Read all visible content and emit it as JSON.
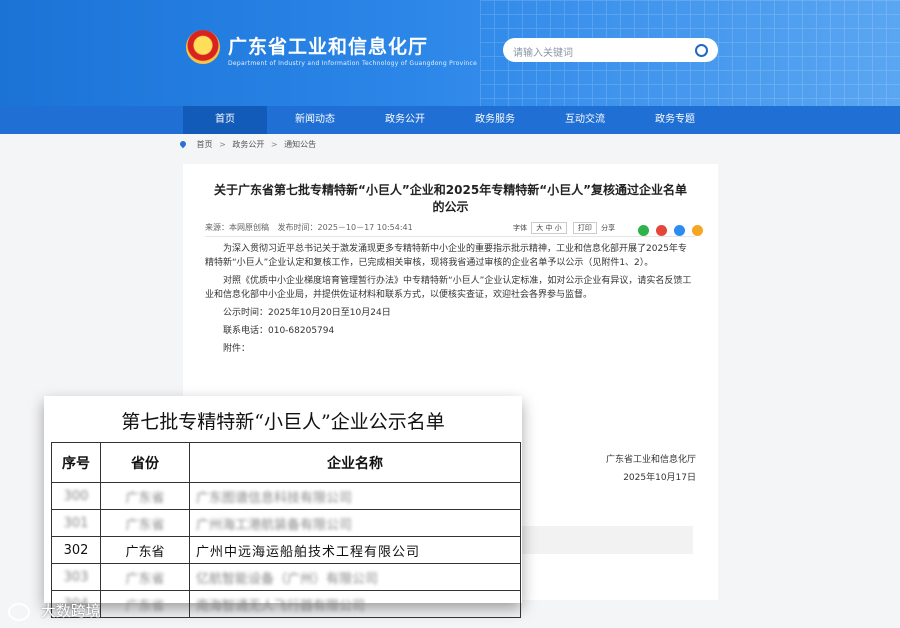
{
  "header": {
    "site_title": "广东省工业和信息化厅",
    "site_subtitle": "Department of Industry and Information Technology of Guangdong Province",
    "search_placeholder": "请输入关键词"
  },
  "nav": {
    "items": [
      "首页",
      "新闻动态",
      "政务公开",
      "政务服务",
      "互动交流",
      "政务专题"
    ]
  },
  "breadcrumb": [
    "首页",
    "政务公开",
    "通知公告"
  ],
  "article": {
    "title_line1": "关于广东省第七批专精特新“小巨人”企业和2025年专精特新“小巨人”复核通过企业名单",
    "title_line2": "的公示",
    "meta_source": "来源：本网原创稿",
    "meta_time": "发布时间：2025－10－17 10:54:41",
    "font_label": "字体",
    "font_sizes": "大 中 小",
    "print_label": "打印",
    "share_label": "分享",
    "paragraph1": "为深入贯彻习近平总书记关于激发涌现更多专精特新中小企业的重要指示批示精神，工业和信息化部开展了2025年专精特新“小巨人”企业认定和复核工作，已完成相关审核，现将我省通过审核的企业名单予以公示（见附件1、2）。",
    "paragraph2": "对照《优质中小企业梯度培育管理暂行办法》中专精特新“小巨人”企业认定标准，如对公示企业有异议，请实名反馈工业和信息化部中小企业局，并提供佐证材料和联系方式，以便核实查证，欢迎社会各界参与监督。",
    "period": "公示时间：2025年10月20日至10月24日",
    "phone": "联系电话：010-68205794",
    "attachment": "附件：",
    "signature": "广东省工业和信息化厅",
    "date": "2025年10月17日"
  },
  "overlay": {
    "title": "第七批专精特新“小巨人”企业公示名单",
    "headers": [
      "序号",
      "省份",
      "企业名称"
    ],
    "rows": [
      {
        "idx": "300",
        "prov": "广东省",
        "name": "广东图谱信息科技有限公司"
      },
      {
        "idx": "301",
        "prov": "广东省",
        "name": "广州海工港航装备有限公司"
      },
      {
        "idx": "302",
        "prov": "广东省",
        "name": "广州中远海运船舶技术工程有限公司"
      },
      {
        "idx": "303",
        "prov": "广东省",
        "name": "亿航智能设备（广州）有限公司"
      },
      {
        "idx": "304",
        "prov": "广东省",
        "name": "南海智通无人飞行器有限公司"
      }
    ]
  },
  "watermark": "大数跨境",
  "colors": {
    "nav_blue": "#1f6fd4",
    "header_blue": "#1b73d6",
    "share_icons": [
      "#2eb24b",
      "#e4473a",
      "#2d8cf0",
      "#f5a623"
    ]
  }
}
